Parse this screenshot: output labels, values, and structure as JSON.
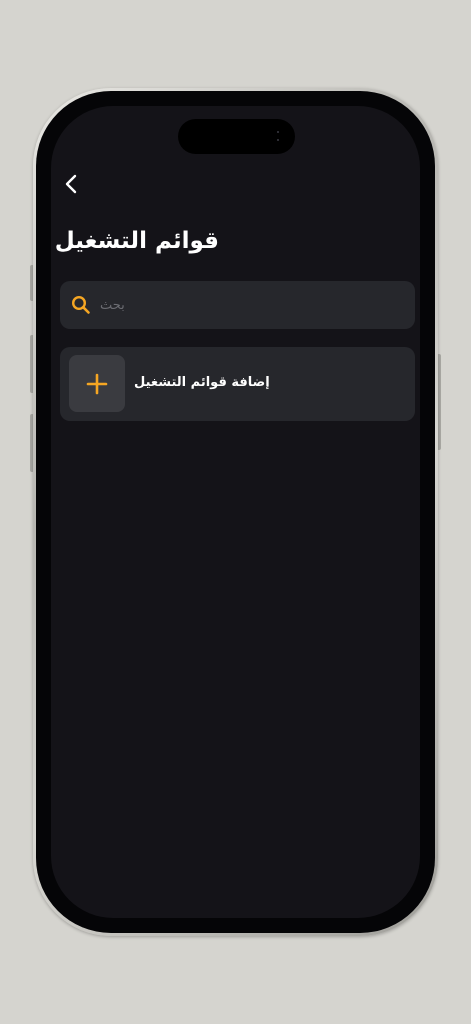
{
  "header": {
    "back_icon": "chevron-left-icon",
    "title": "قوائم التشغيل"
  },
  "search": {
    "icon": "search-icon",
    "placeholder": "بحث",
    "value": ""
  },
  "add_playlist": {
    "icon": "plus-icon",
    "label": "إضافة قوائم التشغيل"
  },
  "colors": {
    "accent": "#f5a623",
    "screen_background": "#141318",
    "card_background": "#26272c",
    "tile_background": "#3a3b40",
    "text_primary": "#ffffff",
    "placeholder": "#6b6c72",
    "page_background": "#d5d4cf"
  }
}
